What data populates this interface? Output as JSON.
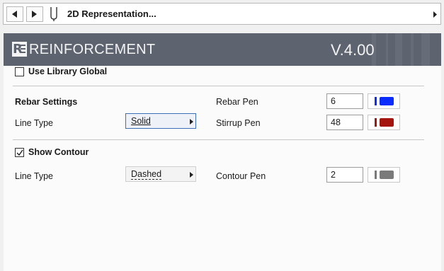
{
  "nav": {
    "back_icon": "triangle-left-icon",
    "forward_icon": "triangle-right-icon",
    "view_icon": "pen-holder-icon",
    "title": "2D Representation...",
    "expand_icon": "triangle-right-icon"
  },
  "header": {
    "logo_text": "RE",
    "title": "REINFORCEMENT",
    "version": "V.4.00"
  },
  "library_global": {
    "label": "Use Library Global",
    "checked": false
  },
  "rebar_settings": {
    "title": "Rebar Settings",
    "line_type_label": "Line Type",
    "line_type_value": "Solid",
    "rebar_pen_label": "Rebar Pen",
    "rebar_pen_value": "6",
    "rebar_pen_color": "#0a2cff",
    "stirrup_pen_label": "Stirrup Pen",
    "stirrup_pen_value": "48",
    "stirrup_pen_color": "#a5150f"
  },
  "contour": {
    "label": "Show Contour",
    "checked": true,
    "line_type_label": "Line Type",
    "line_type_value": "Dashed",
    "contour_pen_label": "Contour Pen",
    "contour_pen_value": "2",
    "contour_pen_color": "#7a7a7a"
  }
}
